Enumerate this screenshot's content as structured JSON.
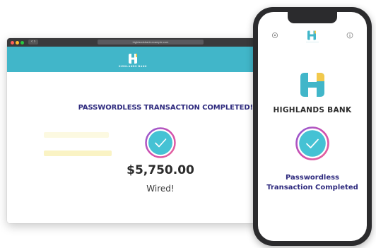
{
  "browser": {
    "address": "highlandsbank.example.com",
    "nav_glyph": "‹ ›",
    "header_brand": "HIGHLANDS BANK"
  },
  "web_page": {
    "headline": "PASSWORDLESS TRANSACTION COMPLETED!",
    "amount": "$5,750.00",
    "status": "Wired!"
  },
  "phone": {
    "bank_name": "HIGHLANDS BANK",
    "message_line1": "Passwordless",
    "message_line2": "Transaction Completed"
  },
  "icons": {
    "browser_logo": "highlands-logo-icon",
    "success_check": "check-circle-icon",
    "phone_settings": "gear-icon",
    "phone_info": "info-icon"
  },
  "colors": {
    "teal": "#41b6c9",
    "navy_text": "#2e2a7e",
    "yellow_accent": "#f2c94c",
    "check_ring": "#c94fb0"
  }
}
